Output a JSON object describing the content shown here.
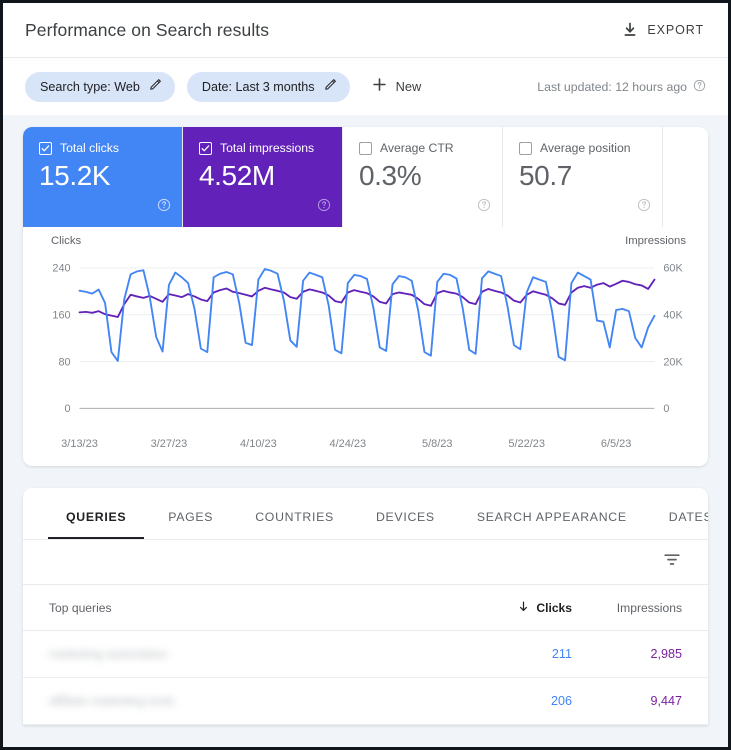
{
  "header": {
    "title": "Performance on Search results",
    "export_label": "EXPORT",
    "export_icon": "download-icon"
  },
  "filters": {
    "chips": [
      {
        "label": "Search type: Web",
        "icon": "pencil-icon"
      },
      {
        "label": "Date: Last 3 months",
        "icon": "pencil-icon"
      }
    ],
    "new_label": "New",
    "new_icon": "plus-icon",
    "last_updated": "Last updated: 12 hours ago",
    "help_icon": "help-circle-icon"
  },
  "metrics": [
    {
      "name": "Total clicks",
      "value": "15.2K",
      "selected": true,
      "color": "#4285f4",
      "help_icon": "help-circle-icon"
    },
    {
      "name": "Total impressions",
      "value": "4.52M",
      "selected": true,
      "color": "#6221b8",
      "help_icon": "help-circle-icon"
    },
    {
      "name": "Average CTR",
      "value": "0.3%",
      "selected": false,
      "color": "#ffffff",
      "help_icon": "help-circle-icon"
    },
    {
      "name": "Average position",
      "value": "50.7",
      "selected": false,
      "color": "#ffffff",
      "help_icon": "help-circle-icon"
    }
  ],
  "chart_data": {
    "type": "line",
    "title": "",
    "xlabel": "",
    "ylabel": "Clicks",
    "y2label": "Impressions",
    "grid": true,
    "legend": "none",
    "left_axis": {
      "label": "Clicks",
      "ticks": [
        "0",
        "80",
        "160",
        "240"
      ],
      "tick_values": [
        0,
        80,
        160,
        240
      ],
      "ylim": [
        0,
        260
      ]
    },
    "right_axis": {
      "label": "Impressions",
      "ticks": [
        "0",
        "20K",
        "40K",
        "60K"
      ],
      "tick_values": [
        0,
        20000,
        40000,
        60000
      ],
      "ylim": [
        0,
        65000
      ]
    },
    "x_ticks": [
      "3/13/23",
      "3/27/23",
      "4/10/23",
      "4/24/23",
      "5/8/23",
      "5/22/23",
      "6/5/23"
    ],
    "x_tick_indices": [
      0,
      14,
      28,
      42,
      56,
      70,
      84
    ],
    "series": [
      {
        "name": "Clicks",
        "color": "#4285f4",
        "axis": "left",
        "values": [
          201,
          199,
          196,
          203,
          180,
          96,
          81,
          186,
          229,
          234,
          236,
          190,
          122,
          97,
          211,
          232,
          224,
          214,
          170,
          102,
          96,
          224,
          230,
          233,
          229,
          180,
          112,
          108,
          220,
          238,
          235,
          230,
          184,
          116,
          105,
          218,
          232,
          228,
          224,
          176,
          100,
          94,
          214,
          228,
          226,
          221,
          172,
          104,
          98,
          212,
          226,
          224,
          218,
          168,
          96,
          90,
          216,
          230,
          228,
          222,
          170,
          100,
          93,
          222,
          234,
          230,
          226,
          174,
          108,
          101,
          198,
          224,
          220,
          216,
          164,
          88,
          82,
          214,
          232,
          226,
          220,
          150,
          148,
          104,
          168,
          170,
          166,
          120,
          104,
          138,
          158
        ]
      },
      {
        "name": "Impressions",
        "color": "#6221b8",
        "axis": "right",
        "values": [
          41000,
          41200,
          40800,
          41500,
          40200,
          39600,
          39000,
          44500,
          48500,
          47800,
          47200,
          48000,
          46800,
          45500,
          48800,
          48200,
          47500,
          48800,
          47800,
          46500,
          45800,
          49500,
          50500,
          51200,
          49800,
          49200,
          48500,
          47800,
          50200,
          51500,
          50800,
          50200,
          49500,
          47500,
          46800,
          49800,
          50800,
          50200,
          49500,
          48200,
          45800,
          45200,
          49500,
          50500,
          49800,
          49200,
          47800,
          45500,
          44800,
          48800,
          49500,
          49000,
          48500,
          46800,
          44500,
          43800,
          49200,
          50200,
          49500,
          49000,
          47500,
          45200,
          44500,
          49800,
          51000,
          50200,
          49500,
          48200,
          46000,
          45200,
          48500,
          50000,
          49200,
          48500,
          47000,
          44800,
          44200,
          49500,
          51500,
          52200,
          51500,
          52800,
          53500,
          52000,
          53200,
          54500,
          54000,
          53000,
          52500,
          51000,
          55000
        ]
      }
    ]
  },
  "table": {
    "tabs": [
      {
        "label": "QUERIES",
        "active": true
      },
      {
        "label": "PAGES",
        "active": false
      },
      {
        "label": "COUNTRIES",
        "active": false
      },
      {
        "label": "DEVICES",
        "active": false
      },
      {
        "label": "SEARCH APPEARANCE",
        "active": false
      },
      {
        "label": "DATES",
        "active": false
      }
    ],
    "filter_icon": "filter-funnel-icon",
    "columns": {
      "query": "Top queries",
      "clicks": "Clicks",
      "impressions": "Impressions",
      "sort_icon": "arrow-down-icon"
    },
    "rows": [
      {
        "query": "marketing automation",
        "clicks": "211",
        "impressions": "2,985"
      },
      {
        "query": "affiliate marketing tools",
        "clicks": "206",
        "impressions": "9,447"
      }
    ]
  },
  "colors": {
    "clicks": "#4285f4",
    "impressions": "#6221b8",
    "impressions_text": "#7b1fa2",
    "page_background": "#f1f5f9",
    "card_background": "#ffffff",
    "chip_background": "#d8e5f8"
  }
}
